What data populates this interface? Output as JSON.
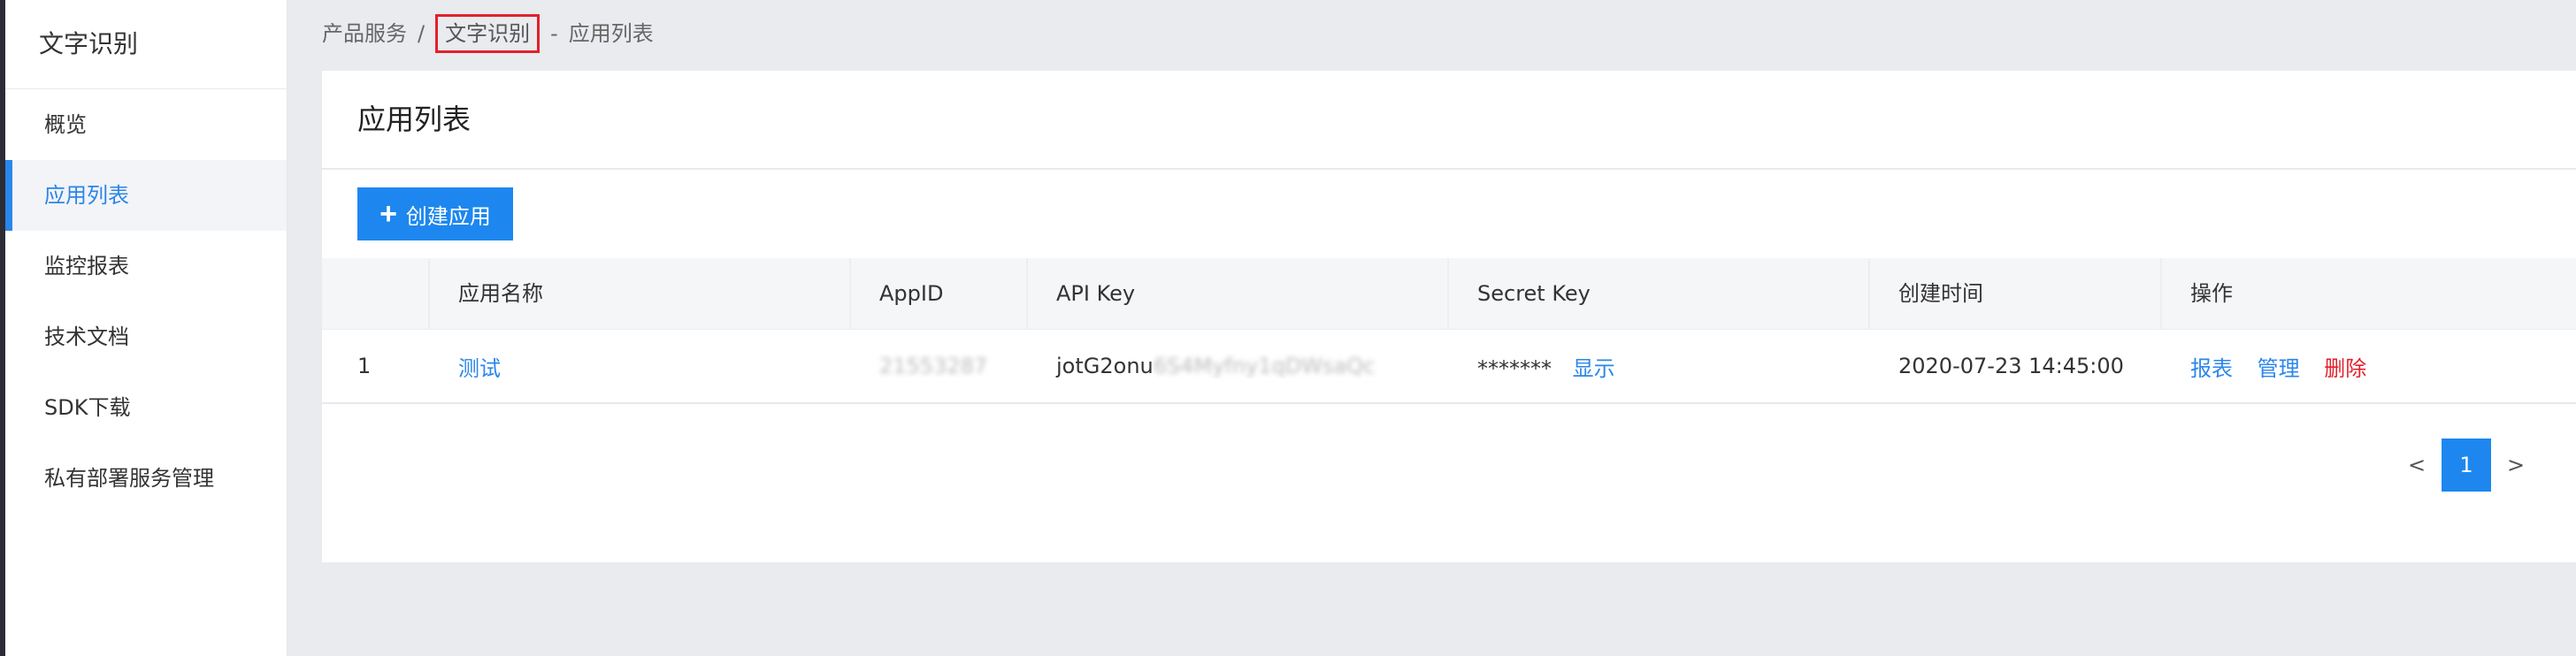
{
  "sidebar": {
    "title": "文字识别",
    "items": [
      {
        "label": "概览",
        "active": false
      },
      {
        "label": "应用列表",
        "active": true
      },
      {
        "label": "监控报表",
        "active": false
      },
      {
        "label": "技术文档",
        "active": false
      },
      {
        "label": "SDK下载",
        "active": false
      },
      {
        "label": "私有部署服务管理",
        "active": false
      }
    ]
  },
  "breadcrumb": {
    "items": [
      "产品服务",
      "文字识别",
      "应用列表"
    ],
    "separators": [
      "/",
      "-"
    ]
  },
  "panel": {
    "title": "应用列表",
    "create_button": "创建应用",
    "create_icon": "plus-icon"
  },
  "table": {
    "headers": [
      "",
      "应用名称",
      "AppID",
      "API Key",
      "Secret Key",
      "创建时间",
      "操作"
    ],
    "rows": [
      {
        "index": "1",
        "name": "测试",
        "appid": "21553287",
        "api_key_visible": "jotG2onu",
        "api_key_blurred": "6S4Myfny1qDWsaQc",
        "secret_key": "*******",
        "secret_show": "显示",
        "created": "2020-07-23 14:45:00",
        "ops": {
          "report": "报表",
          "manage": "管理",
          "delete": "删除"
        }
      }
    ]
  },
  "pagination": {
    "prev": "<",
    "current": "1",
    "next": ">"
  },
  "colors": {
    "accent": "#1d87ef",
    "danger": "#e3202c",
    "highlight_box": "#e3202c"
  }
}
